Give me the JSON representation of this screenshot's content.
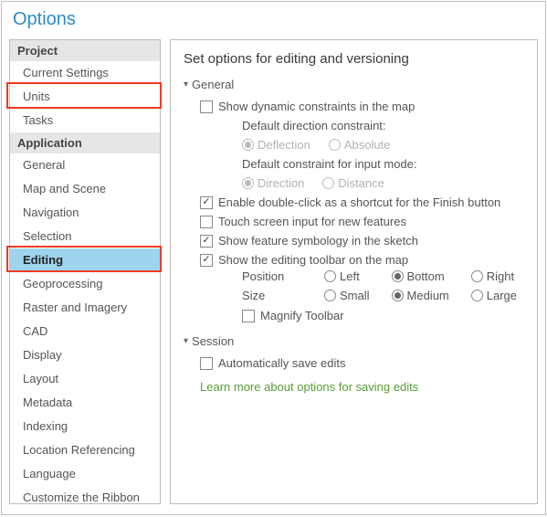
{
  "title": "Options",
  "sidebar": {
    "groups": [
      {
        "label": "Project",
        "items": [
          {
            "label": "Current Settings",
            "selected": false,
            "highlighted": false
          },
          {
            "label": "Units",
            "selected": false,
            "highlighted": true
          },
          {
            "label": "Tasks",
            "selected": false,
            "highlighted": false
          }
        ]
      },
      {
        "label": "Application",
        "items": [
          {
            "label": "General",
            "selected": false,
            "highlighted": false
          },
          {
            "label": "Map and Scene",
            "selected": false,
            "highlighted": false
          },
          {
            "label": "Navigation",
            "selected": false,
            "highlighted": false
          },
          {
            "label": "Selection",
            "selected": false,
            "highlighted": false
          },
          {
            "label": "Editing",
            "selected": true,
            "highlighted": true
          },
          {
            "label": "Geoprocessing",
            "selected": false,
            "highlighted": false
          },
          {
            "label": "Raster and Imagery",
            "selected": false,
            "highlighted": false
          },
          {
            "label": "CAD",
            "selected": false,
            "highlighted": false
          },
          {
            "label": "Display",
            "selected": false,
            "highlighted": false
          },
          {
            "label": "Layout",
            "selected": false,
            "highlighted": false
          },
          {
            "label": "Metadata",
            "selected": false,
            "highlighted": false
          },
          {
            "label": "Indexing",
            "selected": false,
            "highlighted": false
          },
          {
            "label": "Location Referencing",
            "selected": false,
            "highlighted": false
          },
          {
            "label": "Language",
            "selected": false,
            "highlighted": false
          },
          {
            "label": "Customize the Ribbon",
            "selected": false,
            "highlighted": false
          }
        ]
      }
    ]
  },
  "content": {
    "title": "Set options for editing and versioning",
    "general": {
      "label": "General",
      "show_dynamic": {
        "label": "Show dynamic constraints in the map",
        "checked": false
      },
      "default_direction_label": "Default direction constraint:",
      "direction_options": {
        "deflection": "Deflection",
        "absolute": "Absolute",
        "selected": "deflection"
      },
      "default_input_label": "Default constraint for input mode:",
      "input_options": {
        "direction": "Direction",
        "distance": "Distance",
        "selected": "direction"
      },
      "enable_doubleclick": {
        "label": "Enable double-click as a shortcut for the Finish button",
        "checked": true
      },
      "touchscreen": {
        "label": "Touch screen input for new features",
        "checked": false
      },
      "feature_symbology": {
        "label": "Show feature symbology in the sketch",
        "checked": true
      },
      "show_toolbar": {
        "label": "Show the editing toolbar on the map",
        "checked": true
      },
      "position": {
        "label": "Position",
        "options": {
          "left": "Left",
          "bottom": "Bottom",
          "right": "Right"
        },
        "selected": "bottom"
      },
      "size": {
        "label": "Size",
        "options": {
          "small": "Small",
          "medium": "Medium",
          "large": "Large"
        },
        "selected": "medium"
      },
      "magnify": {
        "label": "Magnify Toolbar",
        "checked": false
      }
    },
    "session": {
      "label": "Session",
      "auto_save": {
        "label": "Automatically save edits",
        "checked": false
      }
    },
    "link": "Learn more about options for saving edits"
  }
}
